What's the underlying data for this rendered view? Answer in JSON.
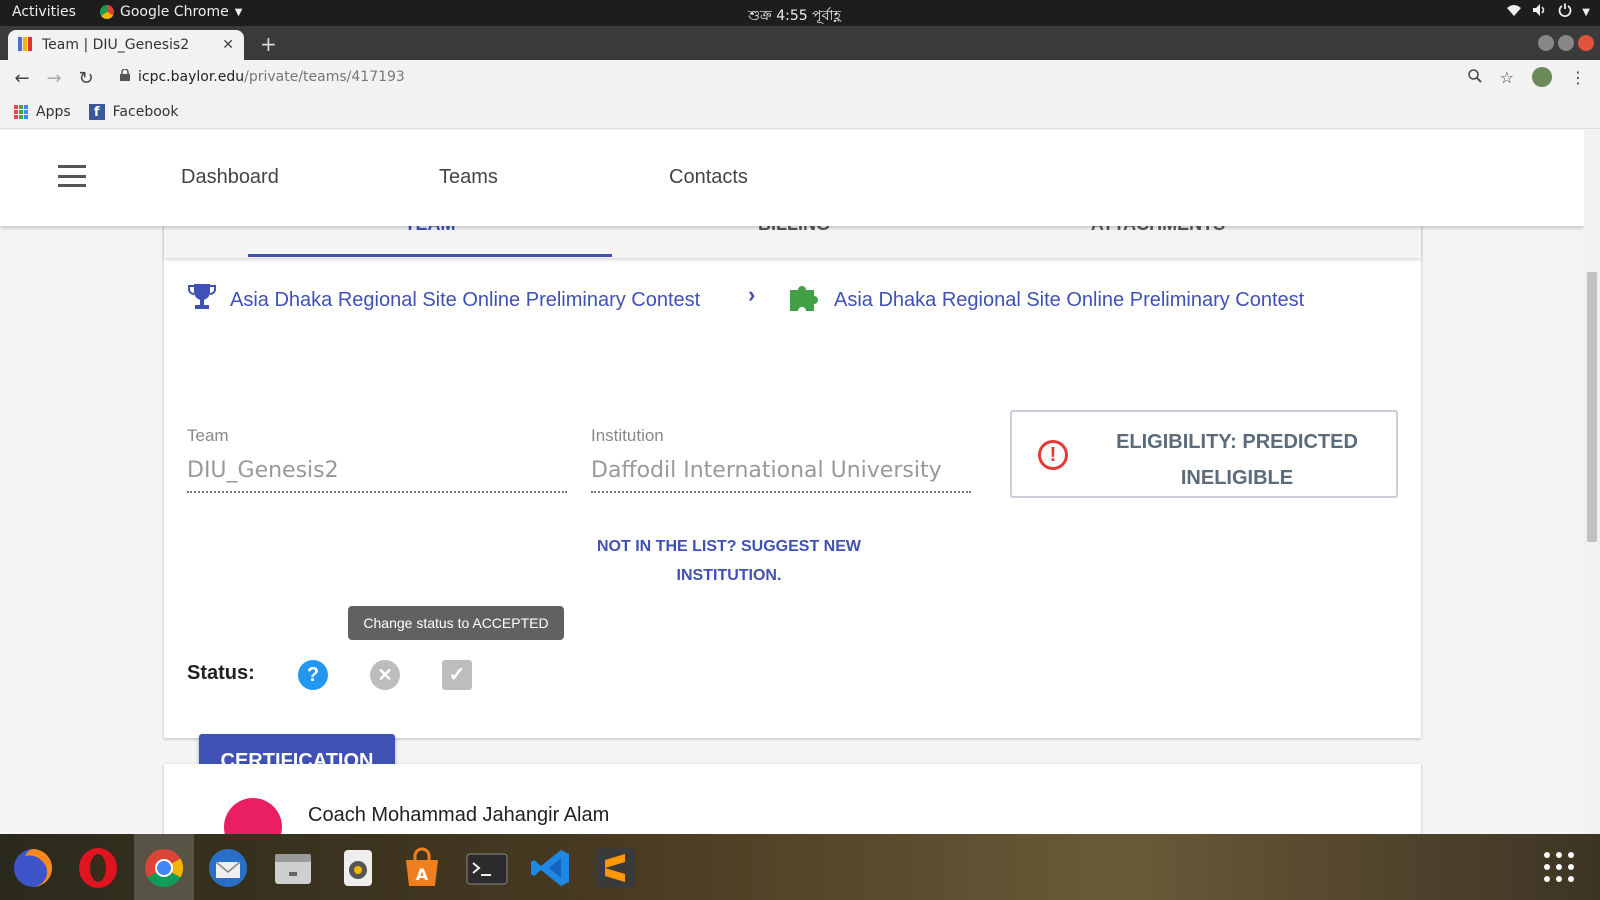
{
  "system_bar": {
    "activities": "Activities",
    "app_name": "Google Chrome",
    "clock": "শুক্র  4:55 পূর্বাহ্ণ"
  },
  "browser": {
    "tab_title": "Team | DIU_Genesis2",
    "url_host": "icpc.baylor.edu",
    "url_path": "/private/teams/417193",
    "bookmarks": [
      {
        "label": "Apps",
        "icon": "apps-grid-icon"
      },
      {
        "label": "Facebook",
        "icon": "facebook-icon"
      }
    ]
  },
  "appbar": {
    "nav": [
      "Dashboard",
      "Teams",
      "Contacts"
    ]
  },
  "card": {
    "tabs": [
      "TEAM",
      "BILLING",
      "ATTACHMENTS"
    ],
    "active_tab": "TEAM",
    "contest_left": "Asia Dhaka Regional Site Online Preliminary Contest",
    "contest_right": "Asia Dhaka Regional Site Online Preliminary Contest",
    "team_label": "Team",
    "team_value": "DIU_Genesis2",
    "institution_label": "Institution",
    "institution_value": "Daffodil International University",
    "eligibility_line1": "ELIGIBILITY: PREDICTED",
    "eligibility_line2": "INELIGIBLE",
    "suggest_line1": "NOT IN THE LIST? SUGGEST NEW",
    "suggest_line2": "INSTITUTION.",
    "tooltip": "Change status to ACCEPTED",
    "status_label": "Status:",
    "certification_button": "CERTIFICATION"
  },
  "coach_card": {
    "name": "Coach Mohammad Jahangir Alam"
  },
  "colors": {
    "primary": "#3f51b5",
    "error": "#e53935",
    "status_pending": "#2196f3",
    "status_inactive": "#bdbdbd"
  }
}
